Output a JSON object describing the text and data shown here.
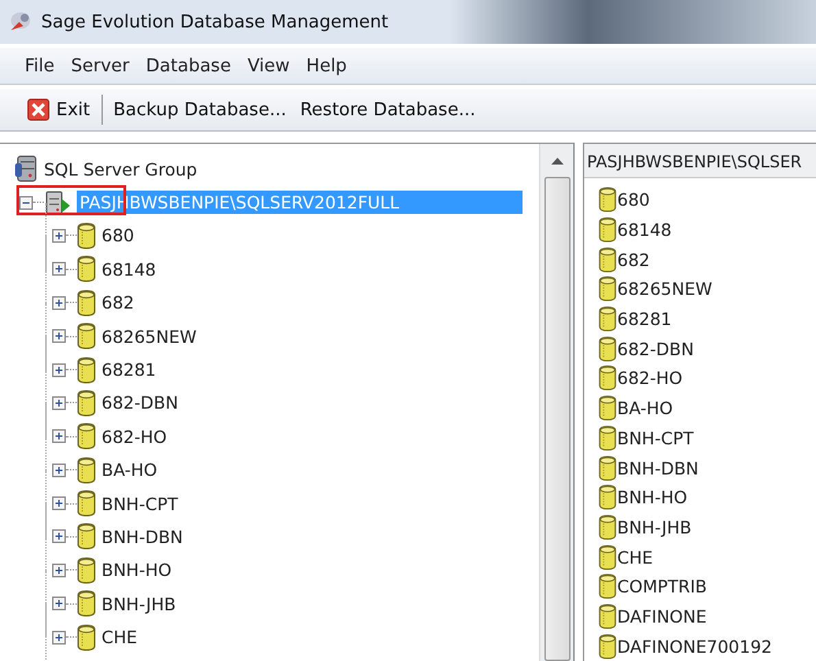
{
  "window": {
    "title": "Sage Evolution Database Management"
  },
  "menu": [
    "File",
    "Server",
    "Database",
    "View",
    "Help"
  ],
  "toolbar": [
    {
      "kind": "exit",
      "label": "Exit"
    },
    {
      "kind": "separator"
    },
    {
      "kind": "text",
      "label": "Backup Database..."
    },
    {
      "kind": "text",
      "label": "Restore Database..."
    }
  ],
  "tree": {
    "label": "SQL Server Group",
    "children": [
      {
        "label": "PASJHBWSBENPIE\\SQLSERV2012FULL",
        "expanded": true,
        "selected": true,
        "annotated": true,
        "children": [
          {
            "label": "680",
            "expanded": false
          },
          {
            "label": "68148",
            "expanded": false
          },
          {
            "label": "682",
            "expanded": false
          },
          {
            "label": "68265NEW",
            "expanded": false
          },
          {
            "label": "68281",
            "expanded": false
          },
          {
            "label": "682-DBN",
            "expanded": false
          },
          {
            "label": "682-HO",
            "expanded": false
          },
          {
            "label": "BA-HO",
            "expanded": false
          },
          {
            "label": "BNH-CPT",
            "expanded": false
          },
          {
            "label": "BNH-DBN",
            "expanded": false
          },
          {
            "label": "BNH-HO",
            "expanded": false
          },
          {
            "label": "BNH-JHB",
            "expanded": false
          },
          {
            "label": "CHE",
            "expanded": false
          }
        ]
      }
    ]
  },
  "detail": {
    "header": "PASJHBWSBENPIE\\SQLSER",
    "items": [
      "680",
      "68148",
      "682",
      "68265NEW",
      "68281",
      "682-DBN",
      "682-HO",
      "BA-HO",
      "BNH-CPT",
      "BNH-DBN",
      "BNH-HO",
      "BNH-JHB",
      "CHE",
      "COMPTRIB",
      "DAFINONE",
      "DAFINONE700192"
    ]
  }
}
